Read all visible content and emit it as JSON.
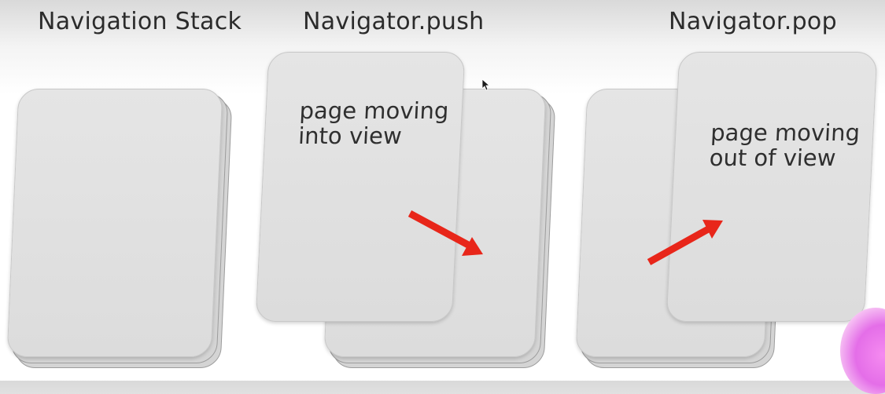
{
  "diagram": {
    "titles": {
      "stack": "Navigation Stack",
      "push": "Navigator.push",
      "pop": "Navigator.pop"
    },
    "push_card_label": {
      "line1": "page moving",
      "line2": "into view"
    },
    "pop_card_label": {
      "line1": "page moving",
      "line2": "out of view"
    },
    "colors": {
      "arrow": "#e8261a",
      "card": "#e0e0e0",
      "card_edge": "#9c9c9c",
      "title_text": "#2b2b2b",
      "corner_blob": "#e46ee8"
    },
    "icons": {
      "cursor": "mouse-cursor-icon",
      "arrow_push": "red-arrow-right-down-icon",
      "arrow_pop": "red-arrow-right-up-icon"
    }
  }
}
